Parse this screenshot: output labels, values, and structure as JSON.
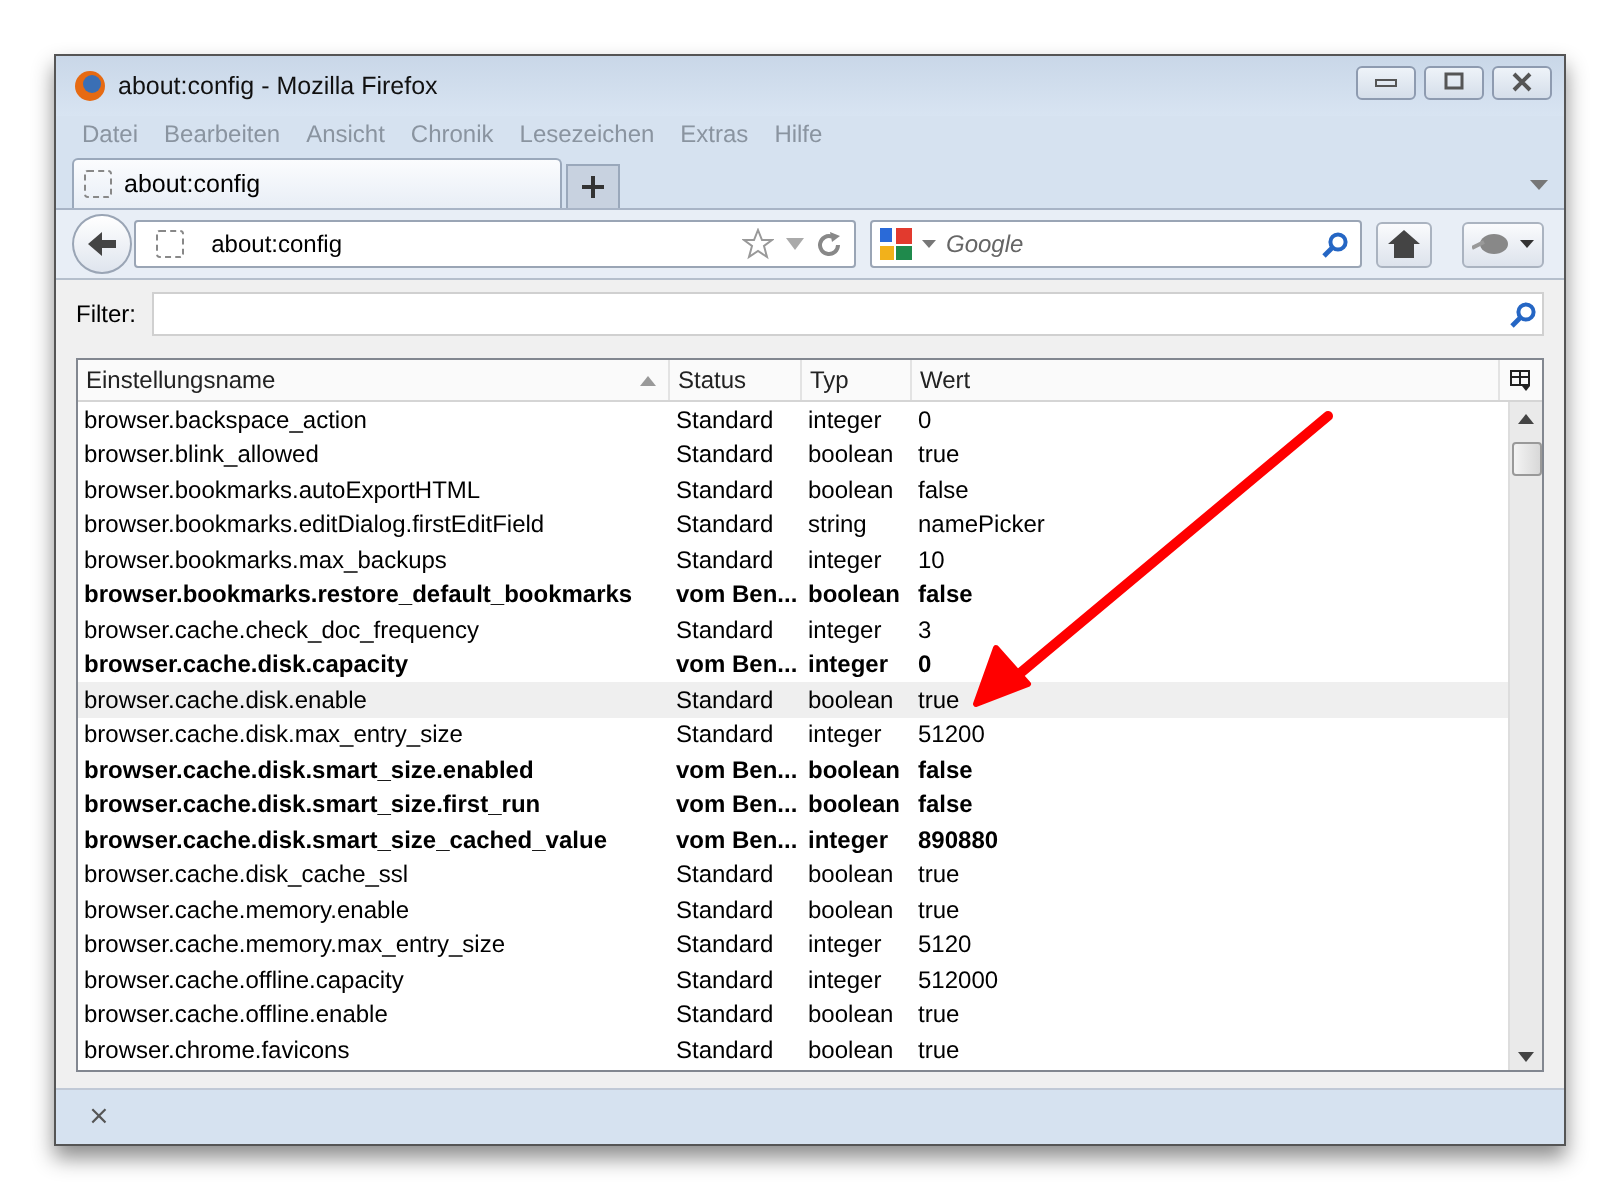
{
  "window": {
    "title": "about:config - Mozilla Firefox"
  },
  "menu": [
    "Datei",
    "Bearbeiten",
    "Ansicht",
    "Chronik",
    "Lesezeichen",
    "Extras",
    "Hilfe"
  ],
  "tabs": [
    {
      "label": "about:config",
      "selected": true
    }
  ],
  "address_bar": {
    "value": "about:config"
  },
  "search": {
    "placeholder": "Google"
  },
  "filter": {
    "label": "Filter:"
  },
  "table": {
    "columns": [
      "Einstellungsname",
      "Status",
      "Typ",
      "Wert"
    ],
    "rows": [
      {
        "name": "browser.backspace_action",
        "status": "Standard",
        "type": "integer",
        "value": "0",
        "modified": false,
        "selected": false
      },
      {
        "name": "browser.blink_allowed",
        "status": "Standard",
        "type": "boolean",
        "value": "true",
        "modified": false,
        "selected": false
      },
      {
        "name": "browser.bookmarks.autoExportHTML",
        "status": "Standard",
        "type": "boolean",
        "value": "false",
        "modified": false,
        "selected": false
      },
      {
        "name": "browser.bookmarks.editDialog.firstEditField",
        "status": "Standard",
        "type": "string",
        "value": "namePicker",
        "modified": false,
        "selected": false
      },
      {
        "name": "browser.bookmarks.max_backups",
        "status": "Standard",
        "type": "integer",
        "value": "10",
        "modified": false,
        "selected": false
      },
      {
        "name": "browser.bookmarks.restore_default_bookmarks",
        "status": "vom Ben...",
        "type": "boolean",
        "value": "false",
        "modified": true,
        "selected": false
      },
      {
        "name": "browser.cache.check_doc_frequency",
        "status": "Standard",
        "type": "integer",
        "value": "3",
        "modified": false,
        "selected": false
      },
      {
        "name": "browser.cache.disk.capacity",
        "status": "vom Ben...",
        "type": "integer",
        "value": "0",
        "modified": true,
        "selected": false
      },
      {
        "name": "browser.cache.disk.enable",
        "status": "Standard",
        "type": "boolean",
        "value": "true",
        "modified": false,
        "selected": true
      },
      {
        "name": "browser.cache.disk.max_entry_size",
        "status": "Standard",
        "type": "integer",
        "value": "51200",
        "modified": false,
        "selected": false
      },
      {
        "name": "browser.cache.disk.smart_size.enabled",
        "status": "vom Ben...",
        "type": "boolean",
        "value": "false",
        "modified": true,
        "selected": false
      },
      {
        "name": "browser.cache.disk.smart_size.first_run",
        "status": "vom Ben...",
        "type": "boolean",
        "value": "false",
        "modified": true,
        "selected": false
      },
      {
        "name": "browser.cache.disk.smart_size_cached_value",
        "status": "vom Ben...",
        "type": "integer",
        "value": "890880",
        "modified": true,
        "selected": false
      },
      {
        "name": "browser.cache.disk_cache_ssl",
        "status": "Standard",
        "type": "boolean",
        "value": "true",
        "modified": false,
        "selected": false
      },
      {
        "name": "browser.cache.memory.enable",
        "status": "Standard",
        "type": "boolean",
        "value": "true",
        "modified": false,
        "selected": false
      },
      {
        "name": "browser.cache.memory.max_entry_size",
        "status": "Standard",
        "type": "integer",
        "value": "5120",
        "modified": false,
        "selected": false
      },
      {
        "name": "browser.cache.offline.capacity",
        "status": "Standard",
        "type": "integer",
        "value": "512000",
        "modified": false,
        "selected": false
      },
      {
        "name": "browser.cache.offline.enable",
        "status": "Standard",
        "type": "boolean",
        "value": "true",
        "modified": false,
        "selected": false
      },
      {
        "name": "browser.chrome.favicons",
        "status": "Standard",
        "type": "boolean",
        "value": "true",
        "modified": false,
        "selected": false
      }
    ]
  },
  "find_bar": {
    "close": "×"
  }
}
